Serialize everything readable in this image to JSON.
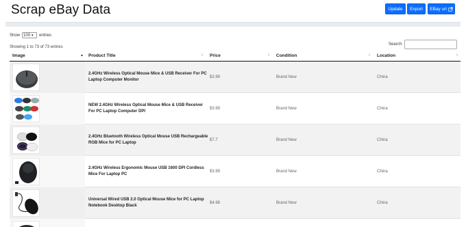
{
  "header": {
    "title": "Scrap eBay Data",
    "buttons": {
      "update": "Update",
      "export": "Export",
      "ebay_url": "EBay url"
    }
  },
  "controls": {
    "show_label": "Show",
    "entries_value": "100",
    "entries_label": "entries",
    "showing_info": "Showing 1 to 73 of 73 entries",
    "search_label": "Search:",
    "search_value": ""
  },
  "table": {
    "columns": [
      "Image",
      "Product Title",
      "Price",
      "Condition",
      "Location"
    ],
    "rows": [
      {
        "title": "2.4GHz Wireless Optical Mouse Mice & USB Receiver For PC Laptop Computer Monitor",
        "price": "$3.99",
        "condition": "Brand New",
        "location": "China"
      },
      {
        "title": "NEW 2.4GHz Wireless Optical Mouse Mice & USB Receiver For PC Laptop Computer DPI",
        "price": "$3.99",
        "condition": "Brand New",
        "location": "China"
      },
      {
        "title": "2.4GHz Bluetooth Wireless Optical Mouse USB Rechargeable RGB Mice for PC Laptop",
        "price": "$7.7",
        "condition": "Brand New",
        "location": "China"
      },
      {
        "title": "2.4GHz Wireless Ergonomic Mouse USB 1600 DPI Cordless Mice For Laptop PC",
        "price": "$3.99",
        "condition": "Brand New",
        "location": "China"
      },
      {
        "title": "Universal Wired USB 2.0 Optical Mouse Mice for PC Laptop Notebook Desktop Black",
        "price": "$4.98",
        "condition": "Brand New",
        "location": "China"
      }
    ]
  },
  "colors": {
    "primary_button": "#0d6efd",
    "header_band": "#e9ecef",
    "stripe": "#f2f2f2"
  }
}
